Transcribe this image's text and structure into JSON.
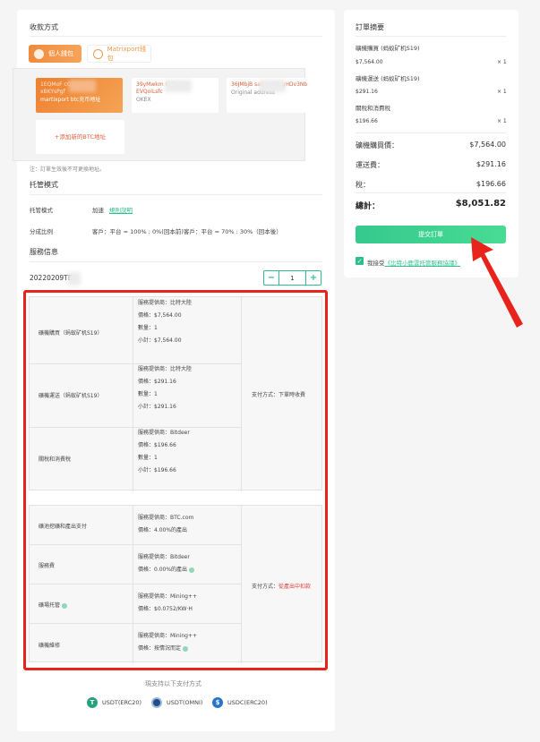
{
  "payment_section": {
    "title": "收款方式",
    "tabs": [
      {
        "label": "個人錢包",
        "active": true
      },
      {
        "label": "Matrixport錢包",
        "active": false
      }
    ],
    "wallets": [
      {
        "address": "1EQMoF           cQJovtC9p xBKYsPgf",
        "sub": "martixport btc充币地址",
        "selected": true
      },
      {
        "address": "39yMwkm           QrDpg7k EVQoiLsfc",
        "sub": "OKEX",
        "selected": false
      },
      {
        "address": "36JMbjB            saBsrvSQ gHDv3Nb",
        "sub": "Original address",
        "selected": false
      }
    ],
    "add_wallet": "+添加新的BTC地址",
    "note": "注：訂單生效後不可更換地址。"
  },
  "custody_section": {
    "title": "托管模式",
    "mode_label": "托管模式",
    "mode_value": "加速",
    "mode_link": "規則說明",
    "split_label": "分成比例",
    "split_value_1": "客戶：平台 = 100% : 0%(回本前)",
    "split_value_2": "客戶：平台 = 70% : 30%（回本後）"
  },
  "service_section": {
    "title": "服務信息",
    "order_id": "20220209TE",
    "quantity": "1",
    "minus": "−",
    "plus": "+",
    "group1": {
      "rows": [
        {
          "name": "礦機購買（蚂蚁矿机S19）",
          "details": [
            "服務提供商：比特大陸",
            "價格：$7,564.00",
            "數量：1",
            "小計：$7,564.00"
          ]
        },
        {
          "name": "礦機運送（蚂蚁矿机S19）",
          "details": [
            "服務提供商：比特大陸",
            "價格：$291.16",
            "數量：1",
            "小計：$291.16"
          ]
        },
        {
          "name": "關稅和消費稅",
          "details": [
            "服務提供商：Bitdeer",
            "價格：$196.66",
            "數量：1",
            "小計：$196.66"
          ]
        }
      ],
      "payment_label": "支付方式：",
      "payment_value": "下單時收費"
    },
    "group2": {
      "rows": [
        {
          "name": "礦池挖礦和產出支付",
          "details": [
            "服務提供商：BTC.com",
            "價格：4.00%的產出"
          ],
          "info": false
        },
        {
          "name": "服務費",
          "details": [
            "服務提供商：Bitdeer",
            "價格：0.00%的產出"
          ],
          "info": true
        },
        {
          "name": "礦場托管",
          "details": [
            "服務提供商：Mining++",
            "價格：$0.0752/KW·H"
          ],
          "info": true,
          "name_info": true
        },
        {
          "name": "礦機維修",
          "details": [
            "服務提供商：Mining++",
            "價格：按情況而定"
          ],
          "info": true
        }
      ],
      "payment_label": "支付方式：",
      "payment_value": "從產出中扣款"
    }
  },
  "supported_payments": {
    "title": "現支持以下支付方式",
    "methods": [
      {
        "label": "USDT(ERC20)",
        "icon": "tether-icon",
        "color": "#26a17b"
      },
      {
        "label": "USDT(OMNI)",
        "icon": "omni-icon",
        "color": "#1e4d8c"
      },
      {
        "label": "USDC(ERC20)",
        "icon": "usdc-icon",
        "color": "#2775ca"
      }
    ]
  },
  "order_summary": {
    "title": "訂單摘要",
    "items": [
      {
        "name": "礦機購買 (蚂蚁矿机S19)",
        "price": "$7,564.00",
        "qty": "× 1"
      },
      {
        "name": "礦機運送 (蚂蚁矿机S19)",
        "price": "$291.16",
        "qty": "× 1"
      },
      {
        "name": "關稅和消費稅",
        "price": "$196.66",
        "qty": "× 1"
      }
    ],
    "hardware_label": "礦機購買價：",
    "hardware_value": "$7,564.00",
    "shipping_label": "運送費：",
    "shipping_value": "$291.16",
    "tax_label": "稅：",
    "tax_value": "$196.66",
    "total_label": "總計：",
    "total_value": "$8,051.82",
    "submit_label": "提交訂單",
    "agree_prefix": "我接受",
    "agree_link": "《比特小鹿雲托管服務協議》"
  },
  "colors": {
    "accent_orange": "#f08a3b",
    "accent_green": "#2fbf8c",
    "highlight_red": "#e8231c"
  }
}
